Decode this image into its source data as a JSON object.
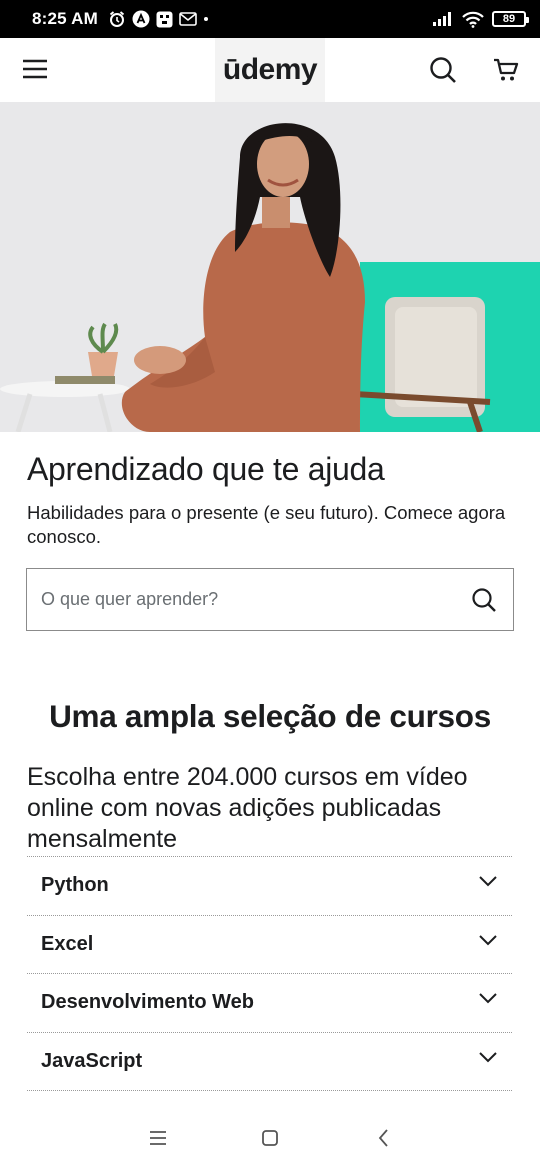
{
  "status_bar": {
    "time": "8:25 AM",
    "battery": "89",
    "icons": [
      "alarm-icon",
      "a-badge-icon",
      "app-badge-icon",
      "mail-icon",
      "dot-icon",
      "signal-icon",
      "wifi-icon",
      "battery-icon"
    ]
  },
  "header": {
    "logo": "ūdemy",
    "icons": [
      "hamburger-menu-icon",
      "search-icon",
      "cart-icon"
    ]
  },
  "hero": {
    "image": "woman-seated-in-armchair-photo"
  },
  "intro": {
    "headline": "Aprendizado que te ajuda",
    "subhead": "Habilidades para o presente (e seu futuro). Comece agora conosco.",
    "search_placeholder": "O que quer aprender?"
  },
  "courses_section": {
    "title": "Uma ampla seleção de cursos",
    "description": "Escolha entre 204.000 cursos em vídeo online com novas adições publicadas mensalmente",
    "topics": [
      {
        "label": "Python"
      },
      {
        "label": "Excel"
      },
      {
        "label": "Desenvolvimento Web"
      },
      {
        "label": "JavaScript"
      }
    ]
  },
  "colors": {
    "brand_purple": "#a435f0",
    "text": "#1c1d1f",
    "hero_teal": "#1ed3b0",
    "status_bar_bg": "#000000"
  },
  "nav_bar": {
    "icons": [
      "recents-icon",
      "home-icon",
      "back-icon"
    ]
  }
}
